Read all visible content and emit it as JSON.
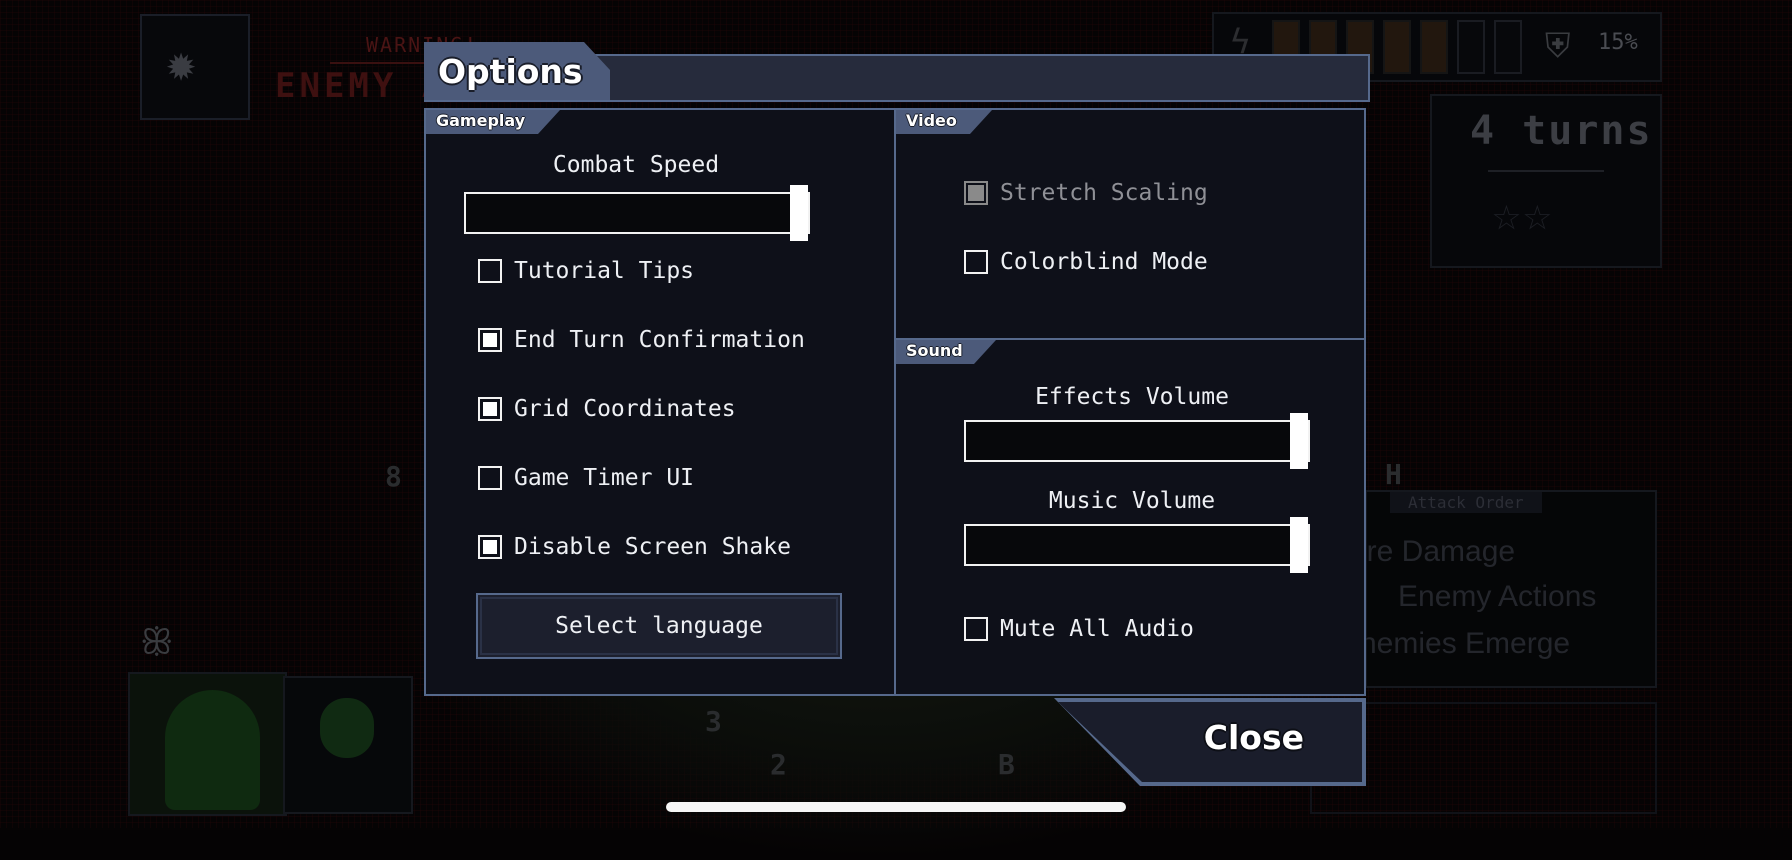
{
  "background": {
    "warning_small": "WARNING!",
    "warning_big": "ENEMY A",
    "power_cells": {
      "filled": 5,
      "total": 7
    },
    "shield_percent": "15%",
    "turns": "4 turns",
    "stars": "☆☆",
    "attack_order": {
      "title": "Attack Order",
      "lines": [
        "ire Damage",
        "Enemy Actions",
        "nemies Emerge"
      ]
    },
    "board_numbers": [
      "8",
      "3",
      "2",
      "B",
      "H"
    ]
  },
  "dialog": {
    "title": "Options",
    "gameplay": {
      "tab": "Gameplay",
      "combat_speed_label": "Combat Speed",
      "combat_speed_value": 1.0,
      "checkboxes": [
        {
          "label": "Tutorial Tips",
          "checked": false
        },
        {
          "label": "End Turn Confirmation",
          "checked": true
        },
        {
          "label": "Grid Coordinates",
          "checked": true
        },
        {
          "label": "Game Timer UI",
          "checked": false
        },
        {
          "label": "Disable Screen Shake",
          "checked": true
        }
      ],
      "language_button": "Select language"
    },
    "video": {
      "tab": "Video",
      "checkboxes": [
        {
          "label": "Stretch Scaling",
          "checked": true,
          "disabled": true
        },
        {
          "label": "Colorblind Mode",
          "checked": false,
          "disabled": false
        }
      ]
    },
    "sound": {
      "tab": "Sound",
      "effects_label": "Effects Volume",
      "effects_value": 1.0,
      "music_label": "Music Volume",
      "music_value": 1.0,
      "mute_label": "Mute All Audio",
      "mute_checked": false
    },
    "close_label": "Close"
  }
}
